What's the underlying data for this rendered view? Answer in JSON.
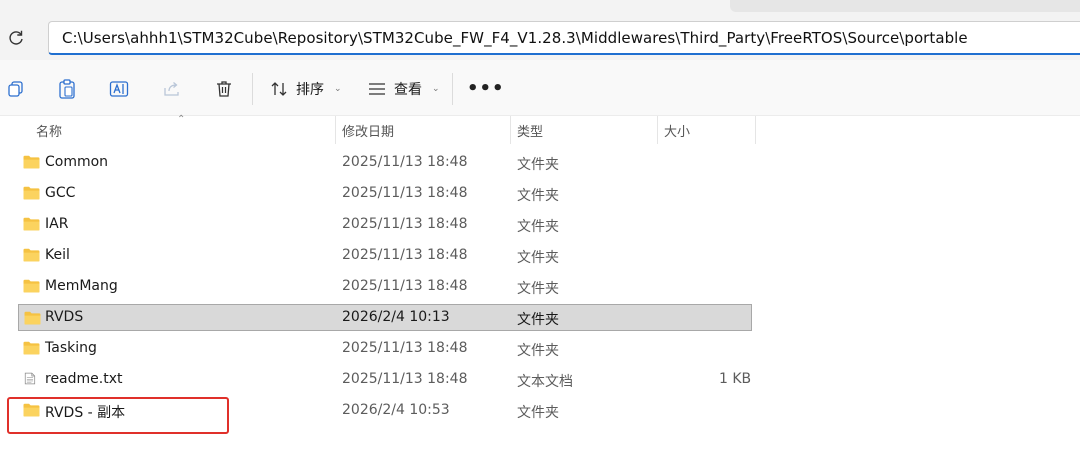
{
  "address_bar": {
    "path": "C:\\Users\\ahhh1\\STM32Cube\\Repository\\STM32Cube_FW_F4_V1.28.3\\Middlewares\\Third_Party\\FreeRTOS\\Source\\portable"
  },
  "toolbar": {
    "sort_label": "排序",
    "view_label": "查看",
    "more_label": "•••"
  },
  "columns": {
    "name": "名称",
    "modified": "修改日期",
    "type": "类型",
    "size": "大小"
  },
  "files": [
    {
      "name": "Common",
      "modified": "2025/11/13 18:48",
      "type": "文件夹",
      "size": "",
      "kind": "folder"
    },
    {
      "name": "GCC",
      "modified": "2025/11/13 18:48",
      "type": "文件夹",
      "size": "",
      "kind": "folder"
    },
    {
      "name": "IAR",
      "modified": "2025/11/13 18:48",
      "type": "文件夹",
      "size": "",
      "kind": "folder"
    },
    {
      "name": "Keil",
      "modified": "2025/11/13 18:48",
      "type": "文件夹",
      "size": "",
      "kind": "folder"
    },
    {
      "name": "MemMang",
      "modified": "2025/11/13 18:48",
      "type": "文件夹",
      "size": "",
      "kind": "folder"
    },
    {
      "name": "RVDS",
      "modified": "2026/2/4 10:13",
      "type": "文件夹",
      "size": "",
      "kind": "folder",
      "selected": true
    },
    {
      "name": "Tasking",
      "modified": "2025/11/13 18:48",
      "type": "文件夹",
      "size": "",
      "kind": "folder"
    },
    {
      "name": "readme.txt",
      "modified": "2025/11/13 18:48",
      "type": "文本文档",
      "size": "1 KB",
      "kind": "text"
    },
    {
      "name": "RVDS - 副本",
      "modified": "2026/2/4 10:53",
      "type": "文件夹",
      "size": "",
      "kind": "folder"
    }
  ],
  "colors": {
    "folder": "#f5c242",
    "selection": "#d9d9d9",
    "highlight_box": "#e0302a",
    "address_focus": "#1f6fd0"
  }
}
